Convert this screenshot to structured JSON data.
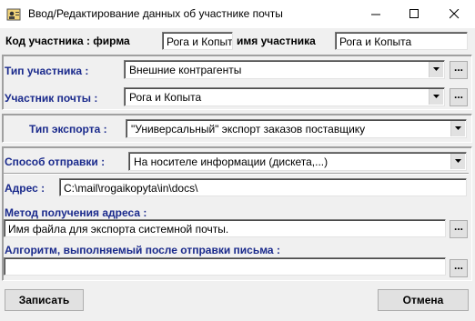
{
  "window": {
    "title": "Ввод/Редактирование данных об участнике почты"
  },
  "participant": {
    "code_label": "Код участника : фирма",
    "firm_value": "Рога и Копыта",
    "name_label": "имя участника",
    "name_value": "Рога и Копыта"
  },
  "type": {
    "label": "Тип участника :",
    "value": "Внешние контрагенты"
  },
  "mail_participant": {
    "label": "Участник почты :",
    "value": "Рога и Копыта"
  },
  "export": {
    "label": "Тип экспорта :",
    "value": "\"Универсальный\" экспорт заказов поставщику"
  },
  "send_method": {
    "label": "Способ отправки :",
    "value": "На носителе информации (дискета,...)"
  },
  "address": {
    "label": "Адрес :",
    "value": "C:\\mail\\rogaikopyta\\in\\docs\\"
  },
  "address_method": {
    "label": "Метод получения адреса :",
    "value": "Имя файла для экспорта системной почты."
  },
  "algorithm": {
    "label": "Алгоритм, выполняемый после отправки письма :",
    "value": ""
  },
  "buttons": {
    "ellipsis": "...",
    "save": "Записать",
    "cancel": "Отмена"
  },
  "colors": {
    "label_blue": "#1a2a8c"
  }
}
